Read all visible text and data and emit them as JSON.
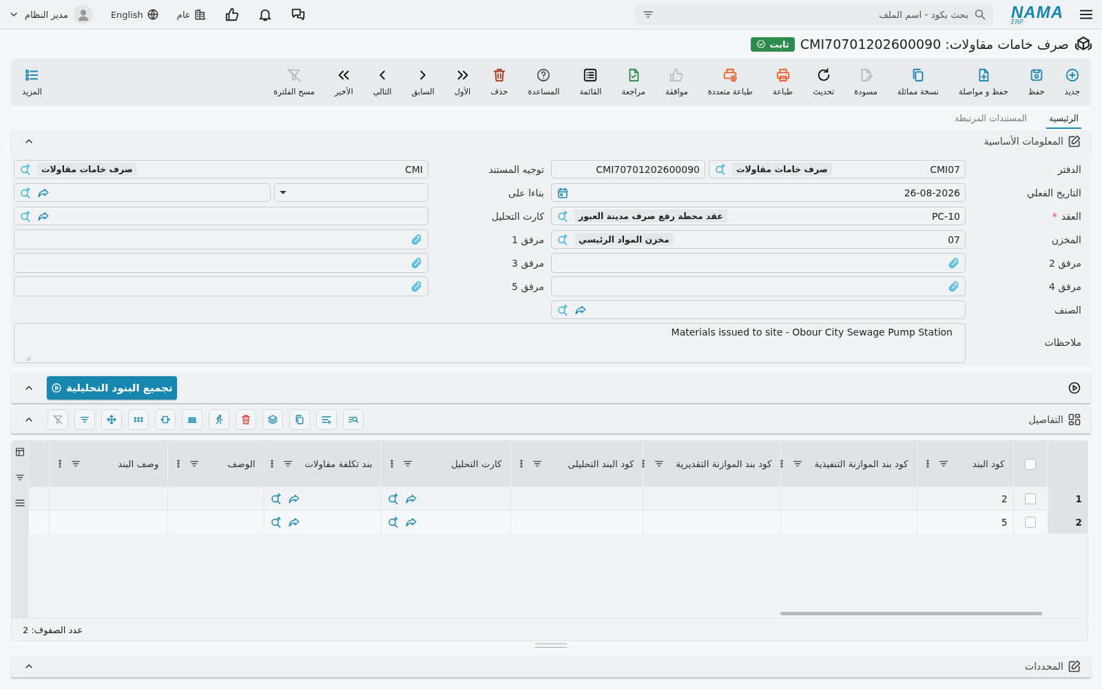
{
  "topbar": {
    "logo": "NAMA",
    "logo_sub": "ERP",
    "search": {
      "placeholder": "بحث بكود - اسم الملف"
    },
    "branch": "عام",
    "language": "English",
    "user": "مدير النظام"
  },
  "document": {
    "title": "صرف خامات مقاولات: CMI70701202600090",
    "status": "ثابت"
  },
  "toolbar": [
    {
      "kind": "new",
      "label": "جديد",
      "disabled": false
    },
    {
      "kind": "save",
      "label": "حفظ",
      "disabled": false
    },
    {
      "kind": "save-continue",
      "label": "حفظ و مواصلة",
      "disabled": false
    },
    {
      "kind": "duplicate",
      "label": "نسخة مماثلة",
      "disabled": false
    },
    {
      "kind": "draft",
      "label": "مسودة",
      "disabled": true
    },
    {
      "kind": "refresh",
      "label": "تحديث",
      "disabled": false
    },
    {
      "kind": "print",
      "label": "طباعة",
      "disabled": false
    },
    {
      "kind": "multi-print",
      "label": "طباعة متعددة",
      "disabled": false
    },
    {
      "kind": "approve",
      "label": "موافقة",
      "disabled": true
    },
    {
      "kind": "review",
      "label": "مراجعة",
      "disabled": false
    },
    {
      "kind": "list",
      "label": "القائمة",
      "disabled": false
    },
    {
      "kind": "help",
      "label": "المساعدة",
      "disabled": false
    },
    {
      "kind": "delete",
      "label": "حذف",
      "disabled": false
    },
    {
      "kind": "first",
      "label": "الأول",
      "disabled": false
    },
    {
      "kind": "previous",
      "label": "السابق",
      "disabled": false
    },
    {
      "kind": "next",
      "label": "التالي",
      "disabled": false
    },
    {
      "kind": "last",
      "label": "الأخير",
      "disabled": false
    },
    {
      "kind": "clear-filter",
      "label": "مسح الفلترة",
      "disabled": true
    }
  ],
  "more_button": {
    "label": "المزيد"
  },
  "tabs": [
    {
      "label": "الرئيسية",
      "selected": true
    },
    {
      "label": "المستندات المرتبطة",
      "selected": false
    }
  ],
  "basic_section": {
    "title": "المعلومات الأساسية"
  },
  "form": {
    "right": [
      {
        "kind": "book",
        "label": "الدفتر",
        "value": "CMI07",
        "tag": "صرف خامات مقاولات",
        "number": "CMI70701202600090"
      },
      {
        "kind": "date",
        "label": "التاريخ الفعلي",
        "value": "26-08-2026"
      },
      {
        "kind": "lookup",
        "label": "العقد",
        "marker": "*",
        "value": "PC-10",
        "tag": "عقد محطة رفع صرف مدينة العبور",
        "link": false
      },
      {
        "kind": "lookup",
        "label": "المخزن",
        "value": "07",
        "tag": "مخزن المواد الرئيسي",
        "link": false
      },
      {
        "kind": "attachment",
        "label": "مرفق 2"
      },
      {
        "kind": "attachment",
        "label": "مرفق 4"
      },
      {
        "kind": "lookup",
        "label": "الصنف",
        "link": true
      }
    ],
    "left": [
      {
        "kind": "lookup",
        "label": "توجيه المستند",
        "value": "CMI",
        "tag": "صرف خامات مقاولات",
        "link": false
      },
      {
        "kind": "select_lookup",
        "label": "بناءا على",
        "link": true
      },
      {
        "kind": "lookup",
        "label": "كارت التحليل",
        "link": true
      },
      {
        "kind": "attachment",
        "label": "مرفق 1"
      },
      {
        "kind": "attachment",
        "label": "مرفق 3"
      },
      {
        "kind": "attachment",
        "label": "مرفق 5"
      }
    ],
    "notes": {
      "label": "ملاحظات",
      "value": "Materials issued to site - Obour City Sewage Pump Station"
    }
  },
  "run_bar": {
    "button": "تجميع البنود التحليلية"
  },
  "details": {
    "title": "التفاصيل",
    "tools": [
      {
        "kind": "search-list",
        "disabled": false
      },
      {
        "kind": "add-line",
        "disabled": false
      },
      {
        "kind": "copy",
        "disabled": false
      },
      {
        "kind": "layers",
        "disabled": false
      },
      {
        "kind": "delete",
        "disabled": false
      },
      {
        "kind": "runner",
        "disabled": false
      },
      {
        "kind": "table",
        "disabled": false
      },
      {
        "kind": "fit",
        "disabled": false
      },
      {
        "kind": "dots",
        "disabled": false
      },
      {
        "kind": "move",
        "disabled": false
      },
      {
        "kind": "filter",
        "disabled": false
      },
      {
        "kind": "clear-filter",
        "disabled": true
      }
    ],
    "select_all": {
      "checked": false
    },
    "columns": [
      {
        "label": "كود البند",
        "kind": "code"
      },
      {
        "label": "كود بند الموازنة التنفيذية",
        "kind": "text"
      },
      {
        "label": "كود بند الموازنة التقديرية",
        "kind": "text"
      },
      {
        "label": "كود البند التحليلى",
        "kind": "text"
      },
      {
        "label": "كارت التحليل",
        "kind": "lookup"
      },
      {
        "label": "بند تكلفة مقاولات",
        "kind": "lookup"
      },
      {
        "label": "الوصف",
        "kind": "text"
      },
      {
        "label": "وصف البند",
        "kind": "text"
      }
    ],
    "rows": [
      {
        "number": "1",
        "checked": false,
        "item_code": "2"
      },
      {
        "number": "2",
        "checked": false,
        "item_code": "5"
      }
    ],
    "footer": "عدد الصفوف: 2"
  },
  "bottom_section": {
    "title": "المحددات"
  }
}
